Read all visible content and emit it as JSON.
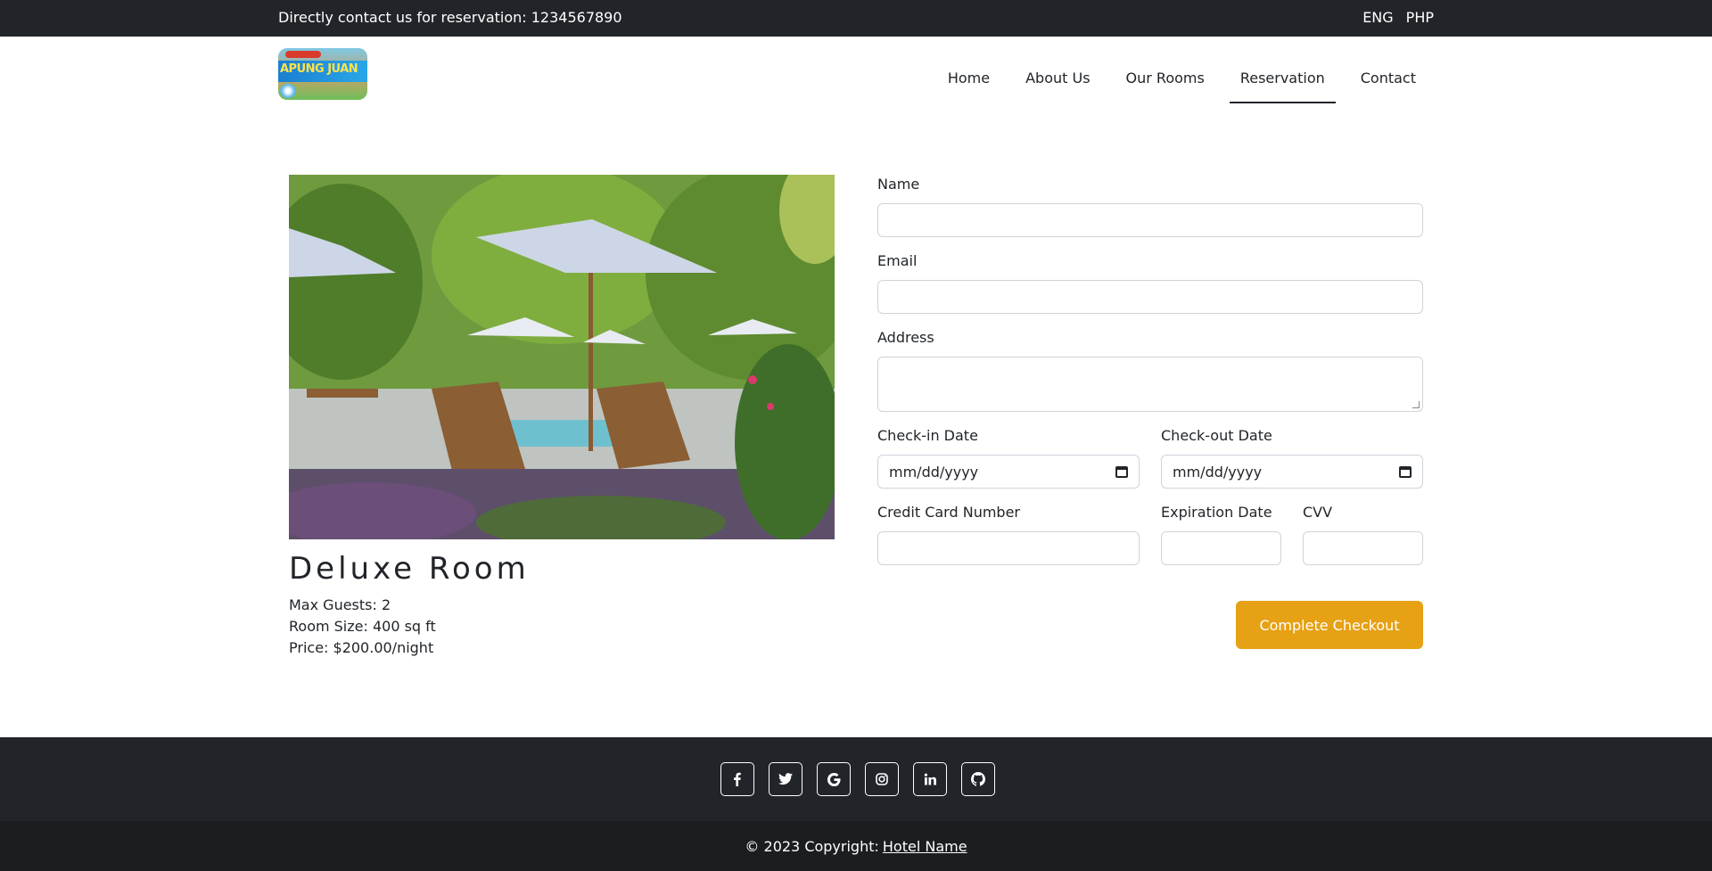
{
  "topbar": {
    "contact_text": "Directly contact us for reservation: 1234567890",
    "languages": [
      "ENG",
      "PHP"
    ]
  },
  "logo": {
    "text": "APUNG JUAN"
  },
  "nav": {
    "items": [
      {
        "label": "Home"
      },
      {
        "label": "About Us"
      },
      {
        "label": "Our Rooms"
      },
      {
        "label": "Reservation",
        "active": true
      },
      {
        "label": "Contact"
      }
    ]
  },
  "room": {
    "title": "Deluxe Room",
    "max_guests": "Max Guests: 2",
    "room_size": "Room Size: 400 sq ft",
    "price": "Price: $200.00/night"
  },
  "form": {
    "name_label": "Name",
    "email_label": "Email",
    "address_label": "Address",
    "checkin_label": "Check-in Date",
    "checkout_label": "Check-out Date",
    "checkin_value": "mm/dd/yyyy",
    "checkout_value": "mm/dd/yyyy",
    "card_label": "Credit Card Number",
    "expiration_label": "Expiration Date",
    "cvv_label": "CVV",
    "submit_label": "Complete Checkout"
  },
  "footer": {
    "social_icons": [
      "facebook-icon",
      "twitter-icon",
      "google-icon",
      "instagram-icon",
      "linkedin-icon",
      "github-icon"
    ],
    "copyright": "© 2023 Copyright:",
    "link_text": "Hotel Name"
  },
  "colors": {
    "dark": "#212529",
    "accent": "#e6a114"
  }
}
